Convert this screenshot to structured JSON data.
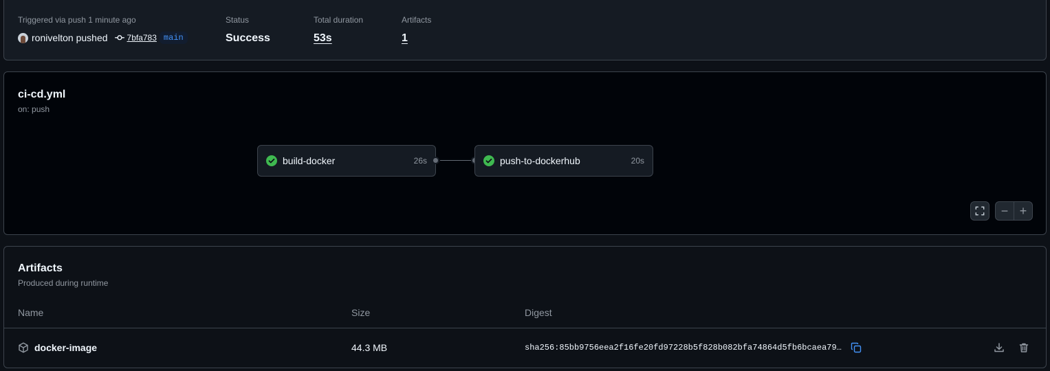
{
  "summary": {
    "trigger_label": "Triggered via push 1 minute ago",
    "pusher": "ronivelton pushed",
    "commit_sha": "7bfa783",
    "branch": "main",
    "status_label": "Status",
    "status_value": "Success",
    "duration_label": "Total duration",
    "duration_value": "53s",
    "artifacts_label": "Artifacts",
    "artifacts_value": "1"
  },
  "workflow": {
    "file": "ci-cd.yml",
    "trigger": "on: push",
    "jobs": [
      {
        "name": "build-docker",
        "duration": "26s",
        "status": "success"
      },
      {
        "name": "push-to-dockerhub",
        "duration": "20s",
        "status": "success"
      }
    ],
    "controls": {
      "zoom_out": "−",
      "zoom_in": "+"
    }
  },
  "artifacts": {
    "title": "Artifacts",
    "subtitle": "Produced during runtime",
    "columns": [
      "Name",
      "Size",
      "Digest"
    ],
    "rows": [
      {
        "name": "docker-image",
        "size": "44.3 MB",
        "digest": "sha256:85bb9756eea2f16fe20fd97228b5f828b082bfa74864d5fb6bcaea79…"
      }
    ]
  },
  "colors": {
    "success": "#3fb950",
    "accent": "#4493f8",
    "background": "#0d1117",
    "muted": "#9198a1"
  },
  "icons": [
    "avatar",
    "git-commit-icon",
    "check-circle-icon",
    "fullscreen-icon",
    "package-icon",
    "copy-icon",
    "download-icon",
    "trash-icon"
  ]
}
